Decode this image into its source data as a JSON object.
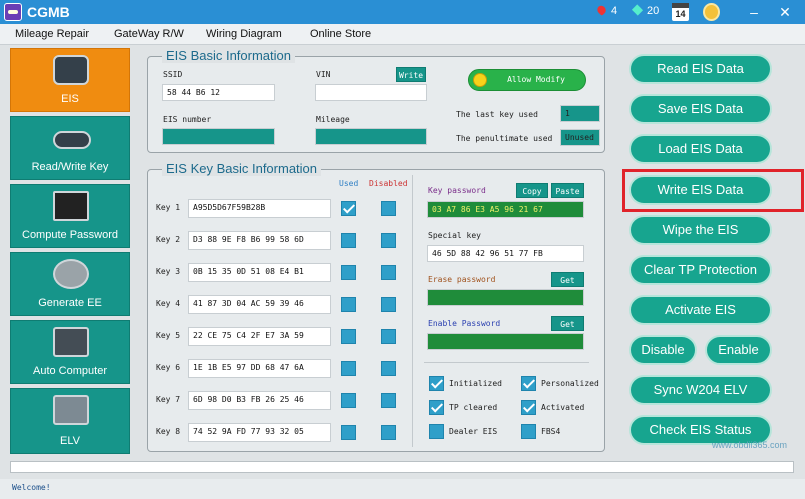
{
  "app": {
    "title": "CGMB"
  },
  "titlebar": {
    "hearts": "4",
    "diamonds": "20",
    "calendar_day": "14"
  },
  "menu": [
    "Mileage Repair",
    "GateWay R/W",
    "Wiring Diagram",
    "Online Store"
  ],
  "sidebar": [
    {
      "label": "EIS"
    },
    {
      "label": "Read/Write Key"
    },
    {
      "label": "Compute Password"
    },
    {
      "label": "Generate EE"
    },
    {
      "label": "Auto Computer"
    },
    {
      "label": "ELV"
    }
  ],
  "eis_basic": {
    "title": "EIS Basic Information",
    "ssid_label": "SSID",
    "ssid_value": "58 44 B6 12",
    "vin_label": "VIN",
    "vin_value": "",
    "write_label": "Write",
    "eis_number_label": "EIS number",
    "eis_number_value": "",
    "mileage_label": "Mileage",
    "mileage_value": "",
    "allow_modify": "Allow Modify",
    "last_key_label": "The last key used",
    "last_key_value": "1",
    "penultimate_label": "The penultimate used",
    "penultimate_value": "Unused"
  },
  "eis_key": {
    "title": "EIS Key Basic Information",
    "used_header": "Used",
    "disabled_header": "Disabled",
    "keys": [
      {
        "label": "Key 1",
        "value": "A95D5D67F59B28B",
        "used": true
      },
      {
        "label": "Key 2",
        "value": "D3 88 9E F8 B6 99 58 6D",
        "used": false
      },
      {
        "label": "Key 3",
        "value": "0B 15 35 0D 51 08 E4 B1",
        "used": false
      },
      {
        "label": "Key 4",
        "value": "41 87 3D 04 AC 59 39 46",
        "used": false
      },
      {
        "label": "Key 5",
        "value": "22 CE 75 C4 2F E7 3A 59",
        "used": false
      },
      {
        "label": "Key 6",
        "value": "1E 1B E5 97 DD 68 47 6A",
        "used": false
      },
      {
        "label": "Key 7",
        "value": "6D 98 D0 B3 FB 26 25 46",
        "used": false
      },
      {
        "label": "Key 8",
        "value": "74 52 9A FD 77 93 32 05",
        "used": false
      }
    ],
    "key_password_label": "Key password",
    "key_password_value": "03 A7 86 E3 A5 96 21 67",
    "copy_label": "Copy",
    "paste_label": "Paste",
    "special_key_label": "Special key",
    "special_key_value": "46 5D 88 42 96 51 77 FB",
    "erase_password_label": "Erase password",
    "erase_get": "Get",
    "enable_password_label": "Enable Password",
    "enable_get": "Get",
    "flags": [
      {
        "label": "Initialized",
        "checked": true
      },
      {
        "label": "Personalized",
        "checked": true
      },
      {
        "label": "TP cleared",
        "checked": true
      },
      {
        "label": "Activated",
        "checked": true
      },
      {
        "label": "Dealer EIS",
        "checked": false
      },
      {
        "label": "FBS4",
        "checked": false
      }
    ]
  },
  "actions": {
    "read": "Read  EIS Data",
    "save": "Save EIS Data",
    "load": "Load EIS Data",
    "write": "Write EIS Data",
    "wipe": "Wipe the EIS",
    "clear_tp": "Clear TP Protection",
    "activate": "Activate EIS",
    "disable": "Disable",
    "enable": "Enable",
    "sync": "Sync W204 ELV",
    "check_status": "Check EIS Status"
  },
  "status": {
    "message": "Welcome!"
  },
  "watermark": "www.obdii365.com",
  "colors": {
    "accent": "#16958a",
    "active": "#f08c10",
    "highlight": "#e0232a"
  }
}
